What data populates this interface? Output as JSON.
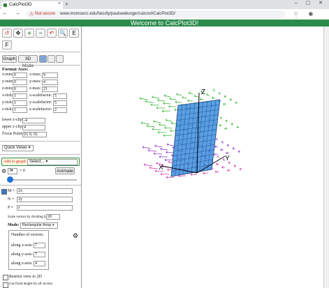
{
  "browser": {
    "tab_title": "CalcPlot3D",
    "tab_close": "×",
    "new_tab": "+",
    "window_controls": "– ▢ ✕",
    "nav_buttons": "← → ⟳",
    "not_secure": "Not secure",
    "url": "www.monroecc.edu/faculty/paulseeburger/calcnsf/CalcPlot3D/",
    "right_controls": "☆ ◉ ⋮"
  },
  "header": {
    "title": "Welcome to CalcPlot3D!"
  },
  "toolbar": {
    "icons": [
      "↺",
      "✥",
      "+",
      "−",
      "↶",
      "🔍",
      "E",
      "F"
    ]
  },
  "view_buttons": {
    "graph": "Graph",
    "mode_3d": "3D Mode"
  },
  "format_axes": {
    "heading": "Format Axes:",
    "rows": [
      {
        "l1": "x-min:",
        "v1": "0",
        "l2": "x-max:",
        "v2": "9"
      },
      {
        "l1": "y-min:",
        "v1": "0",
        "l2": "y-max:",
        "v2": "4"
      },
      {
        "l1": "z-min:",
        "v1": "0",
        "l2": "z-max:",
        "v2": "21"
      },
      {
        "l1": "x-tick:",
        "v1": "1",
        "l2": "x-scalefactor:",
        "v2": "5"
      },
      {
        "l1": "y-tick:",
        "v1": "1",
        "l2": "y-scalefactor:",
        "v2": "5"
      },
      {
        "l1": "z-tick:",
        "v1": "1",
        "l2": "z-scalefactor:",
        "v2": "2"
      }
    ],
    "lower_z_clip_label": "lower z-clip:",
    "lower_z_clip": "-4",
    "upper_z_clip_label": "upper z-clip:",
    "upper_z_clip": "4",
    "focus_label": "Focus Point:",
    "focus": "(0, 0, 0)"
  },
  "quick_views": "Quick Views",
  "add_graph": {
    "label": "Add to graph:",
    "select": "Select..."
  },
  "animate": {
    "var": "t",
    "eq": "= 0",
    "button": "Animate"
  },
  "vector_field": {
    "m_label": "M =",
    "m": "2x",
    "n_label": "N =",
    "n": "2y",
    "p_label": "P =",
    "p": "z",
    "scale_label": "Scale vectors by dividing by:",
    "scale": "20",
    "mode_label": "Mode:",
    "mode": "Rectangular Array",
    "num_label": "Number of vectors:",
    "x_label": "along x-axis:",
    "x": "7",
    "y_label": "along y-axis:",
    "y": "7",
    "z_label": "along z-axis:",
    "z": "4"
  },
  "options": {
    "restrict": "Restrict view to 2D",
    "fixed": "Use fixed length for all vectors"
  },
  "plot": {
    "labels": {
      "x": "X",
      "y": "Y",
      "z": "Z"
    },
    "colors": {
      "surface": "#3d8fe0",
      "mesh": "#1a3d7a",
      "vec_green": "#2bb32b",
      "vec_purple": "#8b2fc9",
      "vec_magenta": "#d02fb0"
    }
  }
}
